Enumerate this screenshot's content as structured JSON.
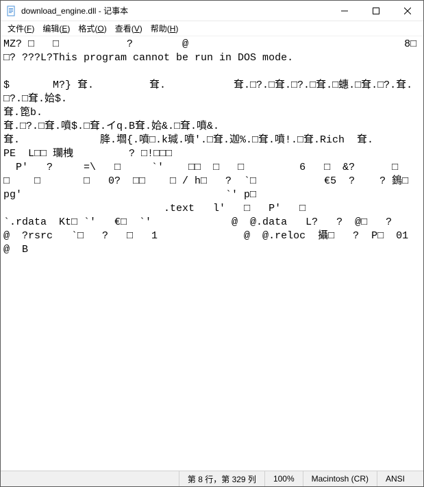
{
  "titlebar": {
    "title": "download_engine.dll - 记事本"
  },
  "menu": {
    "file": "文件(F)",
    "edit": "编辑(E)",
    "format": "格式(O)",
    "view": "查看(V)",
    "help": "帮助(H)"
  },
  "content": "MZ? □   □           ?        @                                   8□   □? ???L?This program cannot be run in DOS mode.\n\n$       M?} 耷.         耷.           耷.□?.□耷.□?.□耷.□蟪.□耷.□?.耷.□?.□耷.姶$.\n耷.箆b.\n耷.□?.□耷.噴$.□耷.イq.B耷.姶&.□耷.噴&.\n耷.             胮.壛{.噴□.k瑊.噴'.□耷.迦%.□耷.噴!.□耷.Rich  耷.                             PE  L□□ 瓓栧         ? □!□□□\n  P'   ?     =\\   □     `'    □□  □   □         6   □  &?      □   □    □       □   0?  □□    □ / h□   ?  `□           €5  ?    ? 鵭□ pg'                                 `' p□\n                          .text   l'   □   P'   □                    `.rdata  Kt□ `'   €□  `'             @  @.data   L?   ?  @□   ?             @  ?rsrc   `□   ?   □   1              @  @.reloc  攝□   ?  P□  01              @  B",
  "status": {
    "position": "第 8 行，第 329 列",
    "zoom": "100%",
    "line_ending": "Macintosh (CR)",
    "encoding": "ANSI"
  }
}
